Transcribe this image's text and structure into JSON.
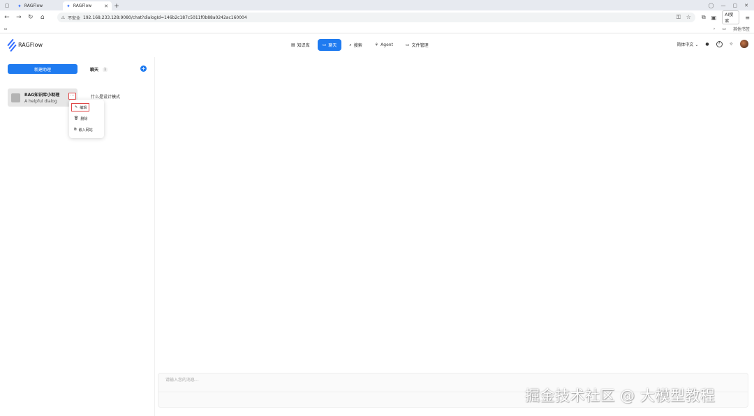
{
  "browser": {
    "tabs": [
      {
        "title": "RAGFlow",
        "active": false
      },
      {
        "title": "RAGFlow",
        "active": true
      }
    ],
    "address": {
      "security": "不安全",
      "url": "192.168.233.128:9080/chat?dialogId=146b2c187c5011f0b88a0242ac160004"
    },
    "ai_search_label": "AI搜索",
    "bookmark_right": "其他书签"
  },
  "app": {
    "logo": "RAGFlow",
    "nav": [
      {
        "label": "知识库",
        "icon": "database-icon",
        "active": false
      },
      {
        "label": "聊天",
        "icon": "chat-icon",
        "active": true
      },
      {
        "label": "搜索",
        "icon": "search-icon",
        "active": false
      },
      {
        "label": "Agent",
        "icon": "agent-icon",
        "active": false
      },
      {
        "label": "文件管理",
        "icon": "folder-icon",
        "active": false
      }
    ],
    "language": "简体中文"
  },
  "sidebar": {
    "create_button": "新建助理",
    "chat_tab": "聊天",
    "chat_count": "1",
    "assistant": {
      "name": "RAG知识库小助理",
      "description": "A helpful dialog"
    },
    "context_menu": [
      {
        "label": "编辑",
        "icon": "edit-icon"
      },
      {
        "label": "删除",
        "icon": "trash-icon"
      },
      {
        "label": "嵌入网站",
        "icon": "embed-icon"
      }
    ]
  },
  "conversation": {
    "item": "什么是设计模式"
  },
  "input": {
    "placeholder": "请输入您的消息..."
  },
  "watermark": "掘金技术社区 @ 大模型教程",
  "colors": {
    "accent": "#1f7bf0",
    "highlight_border": "#e04848"
  }
}
